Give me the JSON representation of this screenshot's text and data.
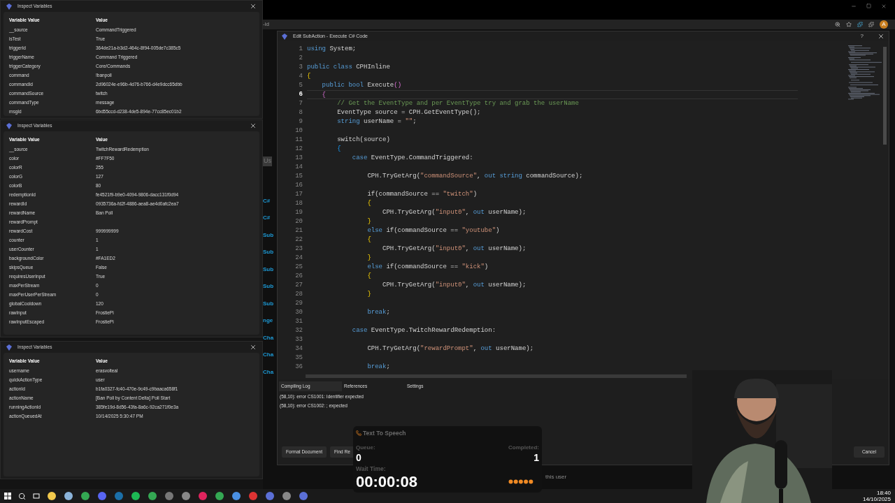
{
  "inspect_panels": [
    {
      "title": "Inspect Variables",
      "columns": [
        "Variable Value",
        "Value"
      ],
      "rows": [
        [
          "__source",
          "CommandTriggered"
        ],
        [
          "isTest",
          "True"
        ],
        [
          "triggerId",
          "364de21a-b3d2-464c-8f94-005de7c385c5"
        ],
        [
          "triggerName",
          "Command Triggered"
        ],
        [
          "triggerCategory",
          "Core/Commands"
        ],
        [
          "command",
          "!banpoll"
        ],
        [
          "commandId",
          "2d96024e-e96b-4d76-b766-d4e9dcc65dbb"
        ],
        [
          "commandSource",
          "twitch"
        ],
        [
          "commandType",
          "message"
        ],
        [
          "msgId",
          "6bd55ccd-d238-4de5-894e-77cc85ec01b2"
        ]
      ]
    },
    {
      "title": "Inspect Variables",
      "columns": [
        "Variable Value",
        "Value"
      ],
      "rows": [
        [
          "__source",
          "TwitchRewardRedemption"
        ],
        [
          "color",
          "#FF7F50"
        ],
        [
          "colorR",
          "255"
        ],
        [
          "colorG",
          "127"
        ],
        [
          "colorB",
          "80"
        ],
        [
          "redemptionId",
          "fe4521f9-b9e0-4094-9806-dacc131f0d94"
        ],
        [
          "rewardId",
          "0935736a-fd2f-4886-aea8-ae4d0afc2ea7"
        ],
        [
          "rewardName",
          "Ban Poll"
        ],
        [
          "rewardPrompt"
        ],
        [
          "rewardCost",
          "999999999"
        ],
        [
          "counter",
          "1"
        ],
        [
          "userCounter",
          "1"
        ],
        [
          "backgroundColor",
          "#FA1ED2"
        ],
        [
          "skipsQueue",
          "False"
        ],
        [
          "requiresUserInput",
          "True"
        ],
        [
          "maxPerStream",
          "0"
        ],
        [
          "maxPerUserPerStream",
          "0"
        ],
        [
          "globalCooldown",
          "120"
        ],
        [
          "rawInput",
          "FrostiePi"
        ],
        [
          "rawInputEscaped",
          "FrostiePi"
        ]
      ]
    },
    {
      "title": "Inspect Variables",
      "columns": [
        "Variable Value",
        "Value"
      ],
      "rows": [
        [
          "username",
          "erasvolteal"
        ],
        [
          "quickActionType",
          "user"
        ],
        [
          "actionId",
          "b1fa0327-fc40-470e-9c49-c9baaca658f1"
        ],
        [
          "actionName",
          "[Ban Poll by Content Delta] Poll Start"
        ],
        [
          "runningActionId",
          "385fe19d-8d56-43fa-8a6c-92ca271f0e3a"
        ],
        [
          "actionQueuedAt",
          "10/14/2025 5:30:47 PM"
        ]
      ]
    }
  ],
  "browser": {
    "address_fragment": "-id",
    "avatar_letter": "A"
  },
  "background_strip": [
    "Us",
    "C#",
    "C#",
    "Sub",
    "Sub",
    "Sub",
    "Sub",
    "Sub",
    "nge",
    "Cha",
    "Cha",
    "Cha"
  ],
  "editor": {
    "title": "Edit SubAction - Execute C# Code",
    "help": "?",
    "lines": [
      {
        "n": "1",
        "current": false,
        "tokens": [
          {
            "kind": "k",
            "text": "using "
          },
          {
            "kind": "t",
            "text": "System;"
          }
        ]
      },
      {
        "n": "2",
        "current": false
      },
      {
        "n": "3",
        "current": false,
        "tokens": [
          {
            "kind": "k",
            "text": "public class "
          },
          {
            "kind": "t",
            "text": "CPHInline"
          }
        ]
      },
      {
        "n": "4",
        "current": false,
        "tokens": [
          {
            "kind": "b1",
            "text": "{"
          }
        ]
      },
      {
        "n": "5",
        "current": false,
        "tokens": [
          {
            "kind": "k",
            "text": "    public bool "
          },
          {
            "kind": "t",
            "text": "Execute"
          },
          {
            "kind": "b2",
            "text": "()"
          }
        ]
      },
      {
        "n": "6",
        "current": true,
        "tokens": [
          {
            "kind": "b2",
            "text": "    {"
          }
        ]
      },
      {
        "n": "7",
        "current": false,
        "tokens": [
          {
            "kind": "c",
            "text": "        // Get the EventType and per EventType try and grab the userName"
          }
        ]
      },
      {
        "n": "8",
        "current": false,
        "tokens": [
          {
            "kind": "t",
            "text": "        EventType source = CPH.GetEventType();"
          }
        ]
      },
      {
        "n": "9",
        "current": false,
        "tokens": [
          {
            "kind": "k",
            "text": "        string "
          },
          {
            "kind": "t",
            "text": "userName = "
          },
          {
            "kind": "s",
            "text": "\"\""
          },
          {
            "kind": "t",
            "text": ";"
          }
        ]
      },
      {
        "n": "10",
        "current": false
      },
      {
        "n": "11",
        "current": false,
        "tokens": [
          {
            "kind": "t",
            "text": "        switch(source)"
          }
        ]
      },
      {
        "n": "12",
        "current": false,
        "tokens": [
          {
            "kind": "b3",
            "text": "        {"
          }
        ]
      },
      {
        "n": "13",
        "current": false,
        "tokens": [
          {
            "kind": "k",
            "text": "            case "
          },
          {
            "kind": "t",
            "text": "EventType.CommandTriggered:"
          }
        ]
      },
      {
        "n": "14",
        "current": false
      },
      {
        "n": "15",
        "current": false,
        "tokens": [
          {
            "kind": "t",
            "text": "                CPH.TryGetArg("
          },
          {
            "kind": "s",
            "text": "\"commandSource\""
          },
          {
            "kind": "t",
            "text": ", "
          },
          {
            "kind": "k",
            "text": "out string "
          },
          {
            "kind": "t",
            "text": "commandSource);"
          }
        ]
      },
      {
        "n": "16",
        "current": false
      },
      {
        "n": "17",
        "current": false,
        "tokens": [
          {
            "kind": "t",
            "text": "                if(commandSource == "
          },
          {
            "kind": "s",
            "text": "\"twitch\""
          },
          {
            "kind": "t",
            "text": ")"
          }
        ]
      },
      {
        "n": "18",
        "current": false,
        "tokens": [
          {
            "kind": "b1",
            "text": "                {"
          }
        ]
      },
      {
        "n": "19",
        "current": false,
        "tokens": [
          {
            "kind": "t",
            "text": "                    CPH.TryGetArg("
          },
          {
            "kind": "s",
            "text": "\"input0\""
          },
          {
            "kind": "t",
            "text": ", "
          },
          {
            "kind": "k",
            "text": "out "
          },
          {
            "kind": "t",
            "text": "userName);"
          }
        ]
      },
      {
        "n": "20",
        "current": false,
        "tokens": [
          {
            "kind": "b1",
            "text": "                }"
          }
        ]
      },
      {
        "n": "21",
        "current": false,
        "tokens": [
          {
            "kind": "k",
            "text": "                else "
          },
          {
            "kind": "t",
            "text": "if(commandSource == "
          },
          {
            "kind": "s",
            "text": "\"youtube\""
          },
          {
            "kind": "t",
            "text": ")"
          }
        ]
      },
      {
        "n": "22",
        "current": false,
        "tokens": [
          {
            "kind": "b1",
            "text": "                {"
          }
        ]
      },
      {
        "n": "23",
        "current": false,
        "tokens": [
          {
            "kind": "t",
            "text": "                    CPH.TryGetArg("
          },
          {
            "kind": "s",
            "text": "\"input0\""
          },
          {
            "kind": "t",
            "text": ", "
          },
          {
            "kind": "k",
            "text": "out "
          },
          {
            "kind": "t",
            "text": "userName);"
          }
        ]
      },
      {
        "n": "24",
        "current": false,
        "tokens": [
          {
            "kind": "b1",
            "text": "                }"
          }
        ]
      },
      {
        "n": "25",
        "current": false,
        "tokens": [
          {
            "kind": "k",
            "text": "                else "
          },
          {
            "kind": "t",
            "text": "if(commandSource == "
          },
          {
            "kind": "s",
            "text": "\"kick\""
          },
          {
            "kind": "t",
            "text": ")"
          }
        ]
      },
      {
        "n": "26",
        "current": false,
        "tokens": [
          {
            "kind": "b1",
            "text": "                {"
          }
        ]
      },
      {
        "n": "27",
        "current": false,
        "tokens": [
          {
            "kind": "t",
            "text": "                    CPH.TryGetArg("
          },
          {
            "kind": "s",
            "text": "\"input0\""
          },
          {
            "kind": "t",
            "text": ", "
          },
          {
            "kind": "k",
            "text": "out "
          },
          {
            "kind": "t",
            "text": "userName);"
          }
        ]
      },
      {
        "n": "28",
        "current": false,
        "tokens": [
          {
            "kind": "b1",
            "text": "                }"
          }
        ]
      },
      {
        "n": "29",
        "current": false
      },
      {
        "n": "30",
        "current": false,
        "tokens": [
          {
            "kind": "k",
            "text": "                break"
          },
          {
            "kind": "t",
            "text": ";"
          }
        ]
      },
      {
        "n": "31",
        "current": false
      },
      {
        "n": "32",
        "current": false,
        "tokens": [
          {
            "kind": "k",
            "text": "            case "
          },
          {
            "kind": "t",
            "text": "EventType.TwitchRewardRedemption:"
          }
        ]
      },
      {
        "n": "33",
        "current": false
      },
      {
        "n": "34",
        "current": false,
        "tokens": [
          {
            "kind": "t",
            "text": "                CPH.TryGetArg("
          },
          {
            "kind": "s",
            "text": "\"rewardPrompt\""
          },
          {
            "kind": "t",
            "text": ", "
          },
          {
            "kind": "k",
            "text": "out "
          },
          {
            "kind": "t",
            "text": "userName);"
          }
        ]
      },
      {
        "n": "35",
        "current": false
      },
      {
        "n": "36",
        "current": false,
        "tokens": [
          {
            "kind": "k",
            "text": "                break"
          },
          {
            "kind": "t",
            "text": ";"
          }
        ]
      }
    ],
    "tabs": [
      {
        "label": "Compiling Log",
        "selected": true
      },
      {
        "label": "References",
        "selected": false
      },
      {
        "label": "Settings",
        "selected": false
      }
    ],
    "log": [
      "(58,10): error CS1001: Identifier expected",
      "(58,10): error CS1002: ; expected"
    ],
    "buttons_left": [
      "Format Document",
      "Find Re"
    ],
    "buttons_right": [
      "Cancel"
    ]
  },
  "behind_text": "this user",
  "tts": {
    "title": "Text To Speech",
    "queue_label": "Queue:",
    "queue": "0",
    "completed_label": "Completed:",
    "completed": "1",
    "wait_label": "Wait Time:",
    "wait": "00:00:08"
  },
  "taskbar": {
    "time": "18:40",
    "date": "14/10/2025"
  }
}
